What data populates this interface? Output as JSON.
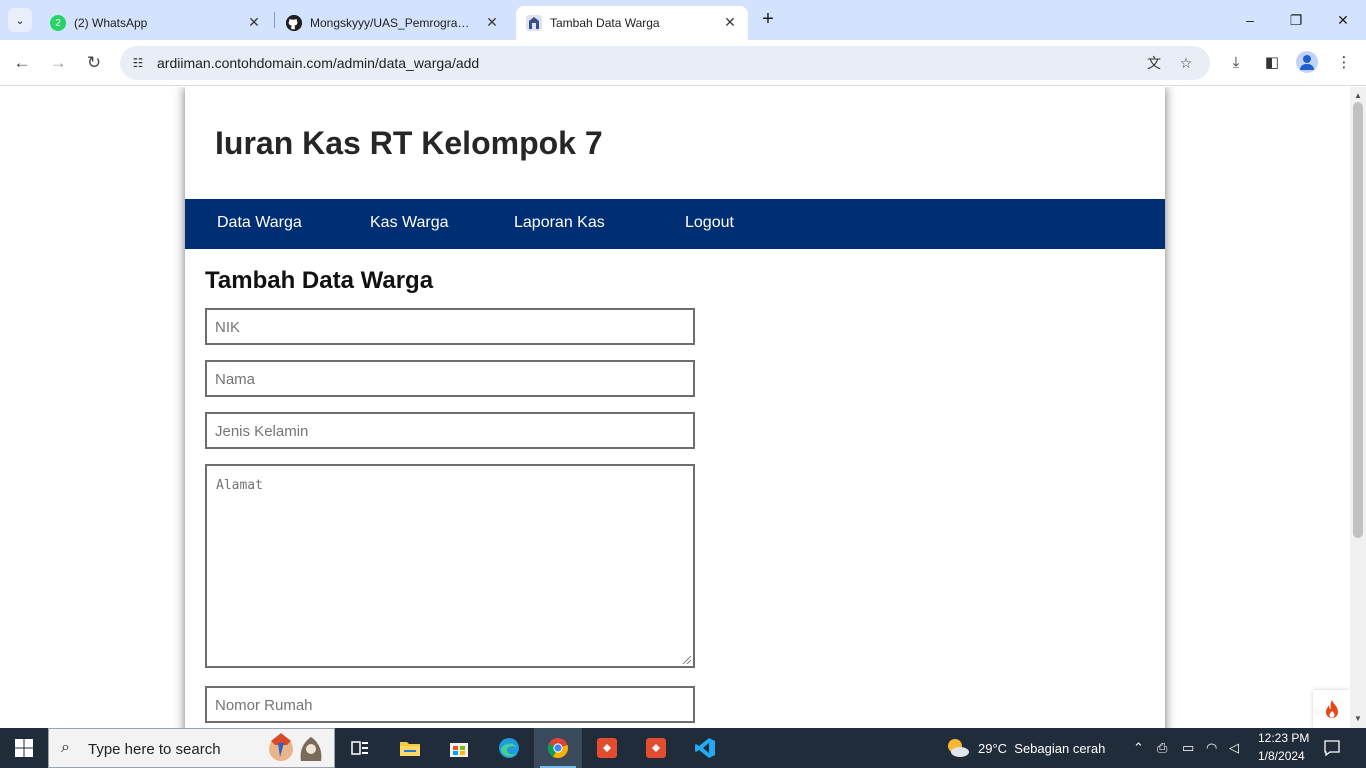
{
  "browser": {
    "tabs": [
      {
        "title": "(2) WhatsApp",
        "favicon_badge": "2",
        "active": false
      },
      {
        "title": "Mongskyyy/UAS_Pemrograman",
        "active": false
      },
      {
        "title": "Tambah Data Warga",
        "active": true
      }
    ],
    "url": "ardiiman.contohdomain.com/admin/data_warga/add"
  },
  "page": {
    "site_title": "Iuran Kas RT Kelompok 7",
    "nav": [
      "Data Warga",
      "Kas Warga",
      "Laporan Kas",
      "Logout"
    ],
    "form": {
      "heading": "Tambah Data Warga",
      "nik_placeholder": "NIK",
      "nama_placeholder": "Nama",
      "jenis_kelamin_placeholder": "Jenis Kelamin",
      "alamat_placeholder": "Alamat",
      "nomor_rumah_placeholder": "Nomor Rumah"
    }
  },
  "taskbar": {
    "search_placeholder": "Type here to search",
    "weather": "29°C  Sebagian cerah",
    "time": "12:23 PM",
    "date": "1/8/2024"
  },
  "colors": {
    "nav_bg": "#002e73",
    "tabstrip_bg": "#d3e3fd",
    "taskbar_bg": "#202c3a"
  }
}
